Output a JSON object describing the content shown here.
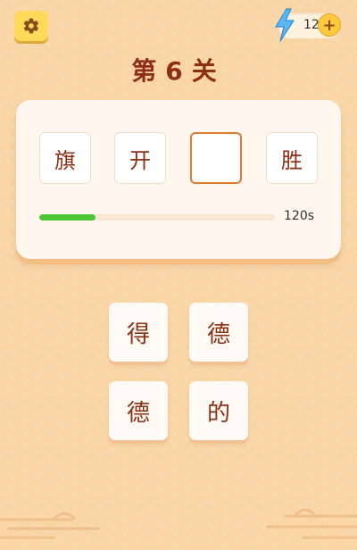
{
  "header": {
    "settings_icon": "gear-icon",
    "energy_icon": "lightning-bolt-icon",
    "energy_count": "12",
    "plus_label": "+"
  },
  "level": {
    "title": "第6关"
  },
  "puzzle": {
    "slots": [
      "旗",
      "开",
      "",
      "胜"
    ],
    "progress_fraction": 0.24,
    "timer_text": "120s"
  },
  "choices": [
    "得",
    "德",
    "德",
    "的"
  ],
  "colors": {
    "background": "#f9d4a4",
    "title": "#8e2e12",
    "accent_yellow": "#ffd95a",
    "progress_green": "#4cc634",
    "empty_slot_border": "#e07a2c"
  }
}
